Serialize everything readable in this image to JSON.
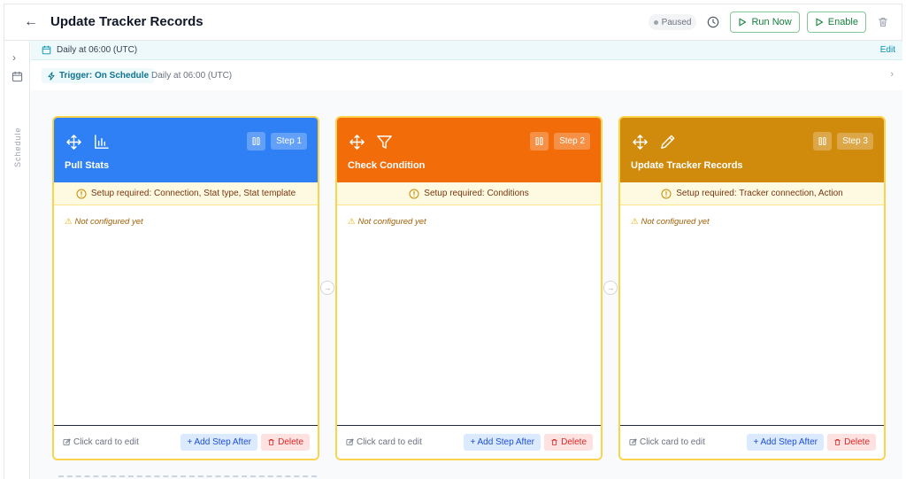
{
  "header": {
    "title": "Update Tracker Records",
    "status": "Paused",
    "run_now": "Run Now",
    "enable": "Enable"
  },
  "rail": {
    "label": "Schedule"
  },
  "schedule": {
    "text": "Daily at 06:00 (UTC)",
    "edit": "Edit"
  },
  "trigger": {
    "label": "Trigger: On Schedule",
    "desc": "Daily at 06:00 (UTC)"
  },
  "colors": {
    "step1": "#2f80f5",
    "step2": "#f26d0a",
    "step3": "#d08a0c",
    "card_border": "#fcd34d"
  },
  "steps": [
    {
      "badge": "Step 1",
      "title": "Pull Stats",
      "icon": "bar-chart-icon",
      "warning": "Setup required: Connection, Stat type, Stat template",
      "status": "Not configured yet",
      "edit_hint": "Click card to edit",
      "add": "+ Add Step After",
      "delete": "Delete"
    },
    {
      "badge": "Step 2",
      "title": "Check Condition",
      "icon": "filter-icon",
      "warning": "Setup required: Conditions",
      "status": "Not configured yet",
      "edit_hint": "Click card to edit",
      "add": "+ Add Step After",
      "delete": "Delete"
    },
    {
      "badge": "Step 3",
      "title": "Update Tracker Records",
      "icon": "pencil-icon",
      "warning": "Setup required: Tracker connection, Action",
      "status": "Not configured yet",
      "edit_hint": "Click card to edit",
      "add": "+ Add Step After",
      "delete": "Delete"
    }
  ]
}
